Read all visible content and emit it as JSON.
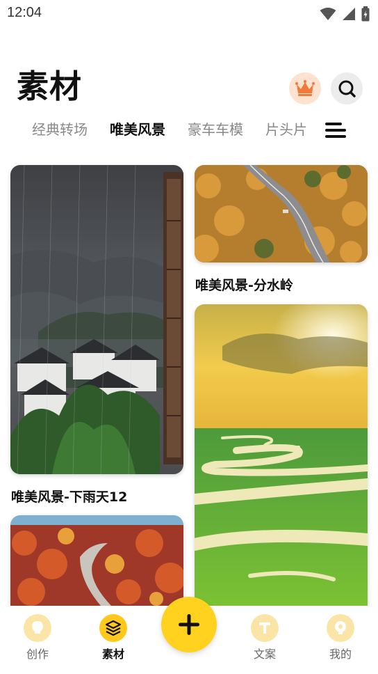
{
  "status_bar": {
    "time": "12:04"
  },
  "header": {
    "title": "素材"
  },
  "tabs": [
    {
      "label": "经典转场",
      "active": false
    },
    {
      "label": "唯美风景",
      "active": true
    },
    {
      "label": "豪车车模",
      "active": false
    },
    {
      "label": "片头片",
      "active": false
    }
  ],
  "cards": [
    {
      "caption": "唯美风景-下雨天12",
      "scene": "rainy-village"
    },
    {
      "caption": "唯美风景-分水岭",
      "scene": "autumn-road"
    },
    {
      "caption": "",
      "scene": "grassland-river-sunset"
    },
    {
      "caption": "",
      "scene": "red-forest-road"
    }
  ],
  "bottom_nav": {
    "items": [
      {
        "label": "创作",
        "icon": "lightbulb-icon",
        "active": false
      },
      {
        "label": "素材",
        "icon": "layers-icon",
        "active": true
      },
      {
        "label": "文案",
        "icon": "text-t-icon",
        "active": false
      },
      {
        "label": "我的",
        "icon": "profile-icon",
        "active": false
      }
    ],
    "fab_icon": "plus-icon"
  },
  "colors": {
    "accent": "#ffd21f",
    "crown_bg": "#fde3cf",
    "crown": "#f07a3a"
  }
}
